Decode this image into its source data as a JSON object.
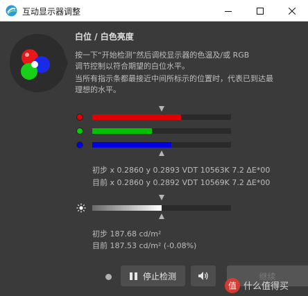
{
  "window": {
    "title": "互动显示器调整",
    "controls": {
      "minimize": "minimize",
      "maximize": "maximize",
      "close": "close"
    }
  },
  "header": {
    "heading": "白位 / 白色亮度",
    "instructions": [
      "按一下“开始检测”然后调校显示器的色温及/或 RGB",
      "调节控制以符合期望的白位水平。",
      "当所有指示条都最接近中间所标示的位置时，代表已到达最",
      "理想的水平。"
    ]
  },
  "rgb": {
    "bars": [
      {
        "channel": "red",
        "color": "#e00000",
        "fill_fraction": 0.64
      },
      {
        "channel": "green",
        "color": "#00c000",
        "fill_fraction": 0.43
      },
      {
        "channel": "blue",
        "color": "#0000e0",
        "fill_fraction": 0.57
      }
    ],
    "target_fraction": 0.5,
    "initial": "初步 x 0.2860 y 0.2893 VDT 10563K 7.2 ΔE*00",
    "current": "目前 x 0.2860 y 0.2892 VDT 10569K 7.2 ΔE*00"
  },
  "luminance": {
    "fill_fraction": 0.5,
    "target_fraction": 0.5,
    "initial": "初步 187.68 cd/m²",
    "current": "目前 187.53 cd/m² (-0.08%)"
  },
  "buttons": {
    "stop": "停止检测",
    "next": "继续"
  },
  "icons": {
    "app": "app-logo-icon",
    "sun": "brightness-icon",
    "pause": "pause-icon",
    "speaker": "speaker-icon"
  },
  "watermark": "值 什么值得买"
}
